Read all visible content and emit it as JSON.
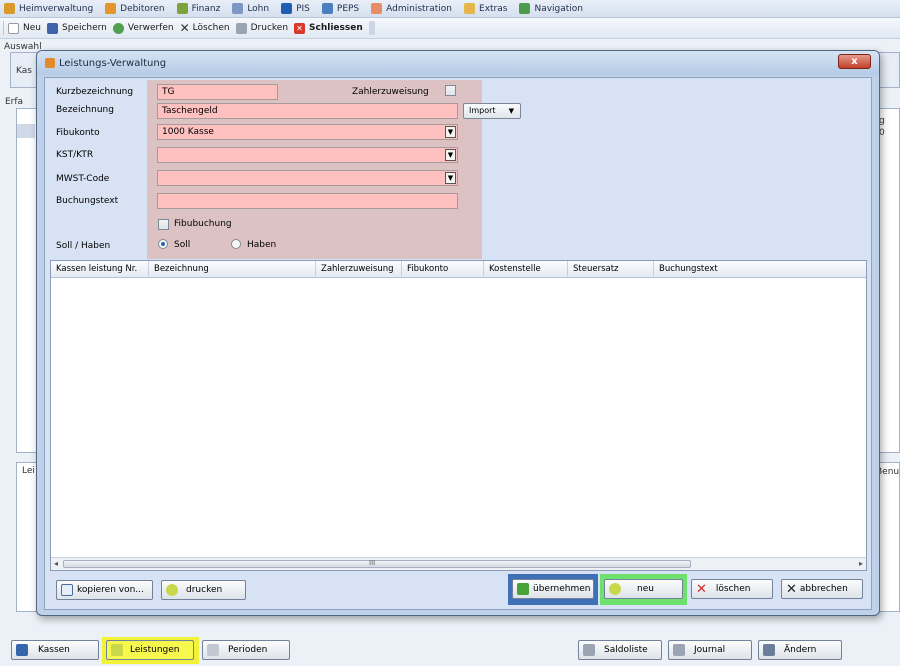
{
  "menubar": {
    "items": [
      {
        "label": "Heimverwaltung",
        "icon": "home-icon",
        "color": "#d99a2b"
      },
      {
        "label": "Debitoren",
        "icon": "people-icon",
        "color": "#e2962c"
      },
      {
        "label": "Finanz",
        "icon": "finance-icon",
        "color": "#7ba33c"
      },
      {
        "label": "Lohn",
        "icon": "payroll-icon",
        "color": "#7f97c4"
      },
      {
        "label": "PIS",
        "icon": "info-icon",
        "color": "#1e5fb4"
      },
      {
        "label": "PEPS",
        "icon": "peps-icon",
        "color": "#4b7fbf"
      },
      {
        "label": "Administration",
        "icon": "admin-icon",
        "color": "#e88d6a"
      },
      {
        "label": "Extras",
        "icon": "extras-icon",
        "color": "#e5b74a"
      },
      {
        "label": "Navigation",
        "icon": "navigation-icon",
        "color": "#4d9c4d"
      }
    ]
  },
  "toolbar": {
    "neu": "Neu",
    "speichern": "Speichern",
    "verwerfen": "Verwerfen",
    "loeschen": "Löschen",
    "drucken": "Drucken",
    "schliessen": "Schliessen"
  },
  "background": {
    "auswahl": "Auswahl",
    "kas": "Kas",
    "erfa": "Erfa",
    "lei": "Lei",
    "benu": "Benu",
    "right_g": "g",
    "right_0": "0"
  },
  "dialog": {
    "title": "Leistungs-Verwaltung",
    "close": "x",
    "form": {
      "kurzbezeichnung_label": "Kurzbezeichnung",
      "kurzbezeichnung_value": "TG",
      "zahlerzuweisung_label": "Zahlerzuweisung",
      "bezeichnung_label": "Bezeichnung",
      "bezeichnung_value": "Taschengeld",
      "import_label": "Import",
      "fibukonto_label": "Fibukonto",
      "fibukonto_value": "1000 Kasse",
      "kst_label": "KST/KTR",
      "kst_value": "",
      "mwst_label": "MWST-Code",
      "mwst_value": "",
      "buchungstext_label": "Buchungstext",
      "buchungstext_value": "",
      "fibubuchung_label": "Fibubuchung",
      "sollhaben_label": "Soll / Haben",
      "soll_label": "Soll",
      "haben_label": "Haben",
      "soll_selected": true
    },
    "grid": {
      "columns": [
        "Kassen leistung Nr.",
        "Bezeichnung",
        "Zahlerzuweisung",
        "Fibukonto",
        "Kostenstelle",
        "Steuersatz",
        "Buchungstext"
      ],
      "rows": []
    },
    "buttons": {
      "kopieren": "kopieren von...",
      "drucken": "drucken",
      "uebernehmen": "übernehmen",
      "neu": "neu",
      "loeschen": "löschen",
      "abbrechen": "abbrechen"
    }
  },
  "bottombar": {
    "kassen": "Kassen",
    "leistungen": "Leistungen",
    "perioden": "Perioden",
    "saldoliste": "Saldoliste",
    "journal": "Journal",
    "aendern": "Ändern"
  }
}
